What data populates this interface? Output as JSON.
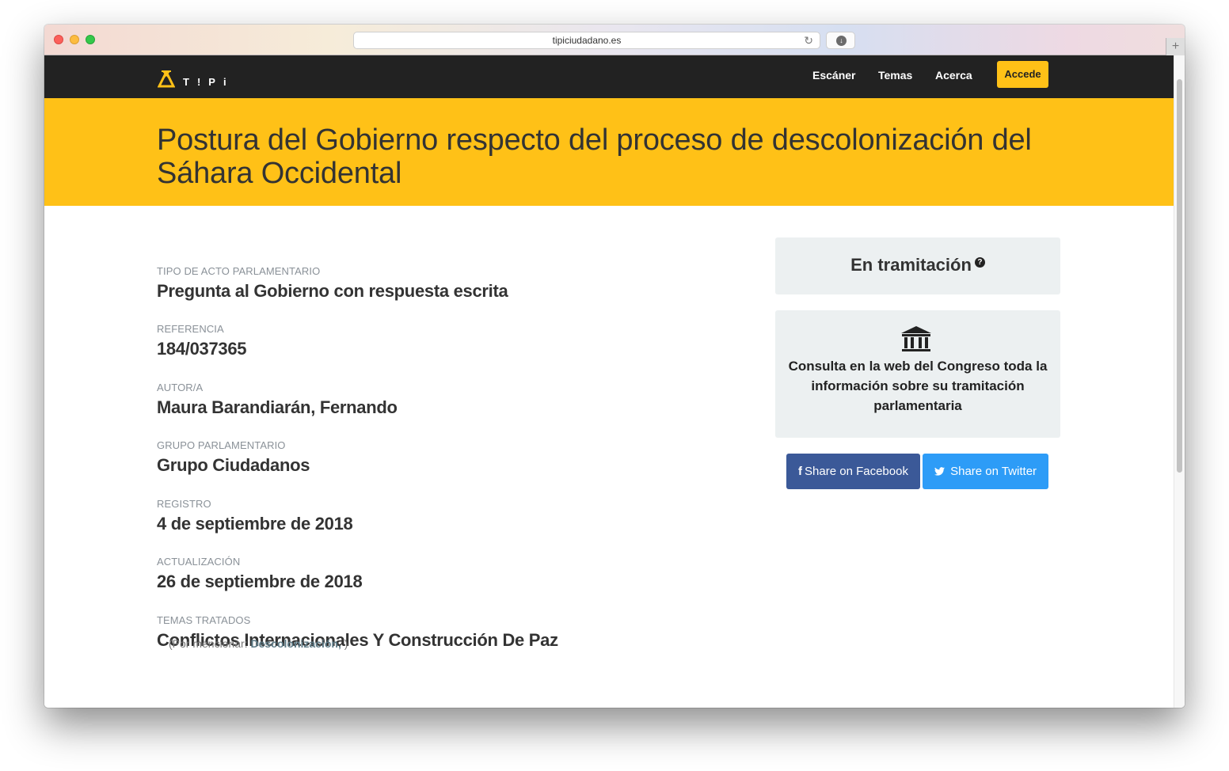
{
  "browser": {
    "url": "tipiciudadano.es"
  },
  "nav": {
    "logo_text": "T!Pi",
    "links": [
      "Escáner",
      "Temas",
      "Acerca"
    ],
    "login_label": "Accede"
  },
  "page": {
    "title": "Postura del Gobierno respecto del proceso de descolonización del Sáhara Occidental"
  },
  "fields": [
    {
      "label": "TIPO DE ACTO PARLAMENTARIO",
      "value": "Pregunta al Gobierno con respuesta escrita"
    },
    {
      "label": "REFERENCIA",
      "value": "184/037365"
    },
    {
      "label": "AUTOR/A",
      "value": "Maura Barandiarán, Fernando"
    },
    {
      "label": "GRUPO PARLAMENTARIO",
      "value": "Grupo Ciudadanos"
    },
    {
      "label": "REGISTRO",
      "value": "4 de septiembre de 2018"
    },
    {
      "label": "ACTUALIZACIÓN",
      "value": "26 de septiembre de 2018"
    },
    {
      "label": "TEMAS TRATADOS",
      "value": "Conflictos Internacionales Y Construcción De Paz"
    }
  ],
  "mentions": {
    "prefix": "(Por mencionar:",
    "link": "Descolonización,",
    "suffix": ")"
  },
  "sidebar": {
    "status": "En tramitación",
    "help_icon": "?",
    "congress_text": "Consulta en la web del Congreso toda la información sobre su tramitación parlamentaria",
    "share_facebook": "Share on Facebook",
    "share_twitter": "Share on Twitter"
  },
  "colors": {
    "accent": "#ffc117",
    "navbar": "#222222",
    "facebook": "#3b5998",
    "twitter": "#2d9cf7",
    "panel": "#ecf0f1"
  }
}
